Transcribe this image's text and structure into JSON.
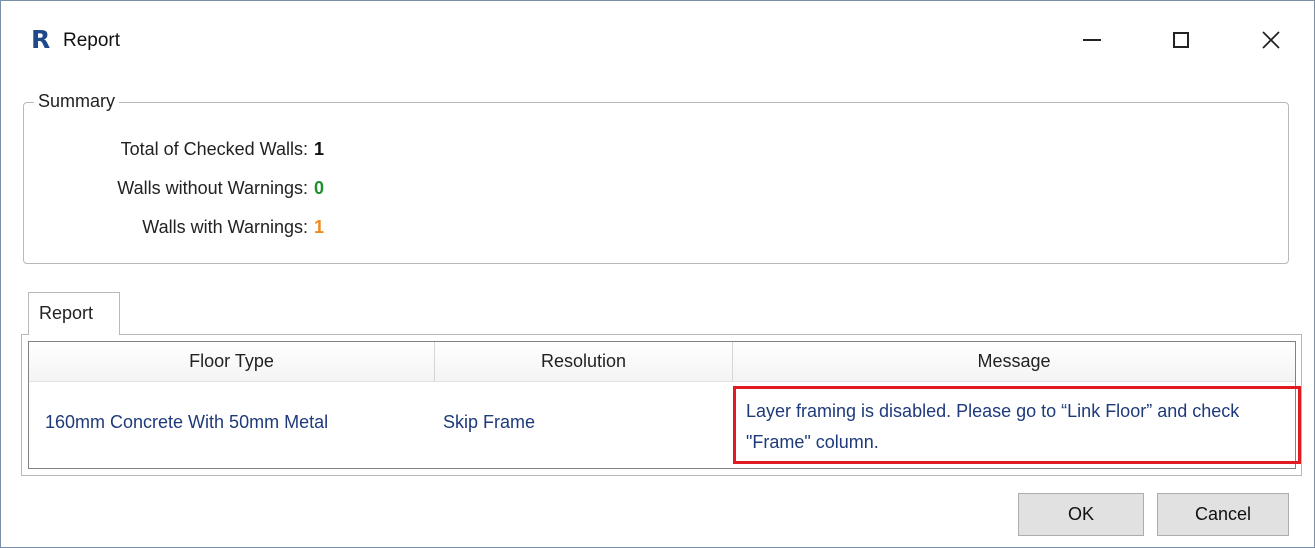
{
  "window": {
    "title": "Report",
    "app_icon_glyph": "R",
    "app_icon_color": "#1e4a8c",
    "controls": [
      "minimize-icon",
      "maximize-icon",
      "close-icon"
    ],
    "close_glyph": "✕"
  },
  "summary": {
    "legend": "Summary",
    "rows": [
      {
        "label": "Total of Checked Walls:",
        "value": "1",
        "color": "#111111"
      },
      {
        "label": "Walls without Warnings:",
        "value": "0",
        "color": "#1f8f2e"
      },
      {
        "label": "Walls with Warnings:",
        "value": "1",
        "color": "#f08a1c"
      }
    ]
  },
  "report_tab": {
    "label": "Report",
    "columns": [
      "Floor Type",
      "Resolution",
      "Message"
    ],
    "rows": [
      {
        "floor_type": "160mm Concrete With 50mm Metal",
        "resolution": "Skip Frame",
        "message": "Layer framing is disabled. Please go to “Link Floor” and check \"Frame\" column."
      }
    ],
    "highlight_color": "#e11b22"
  },
  "buttons": {
    "ok_label": "OK",
    "cancel_label": "Cancel"
  }
}
